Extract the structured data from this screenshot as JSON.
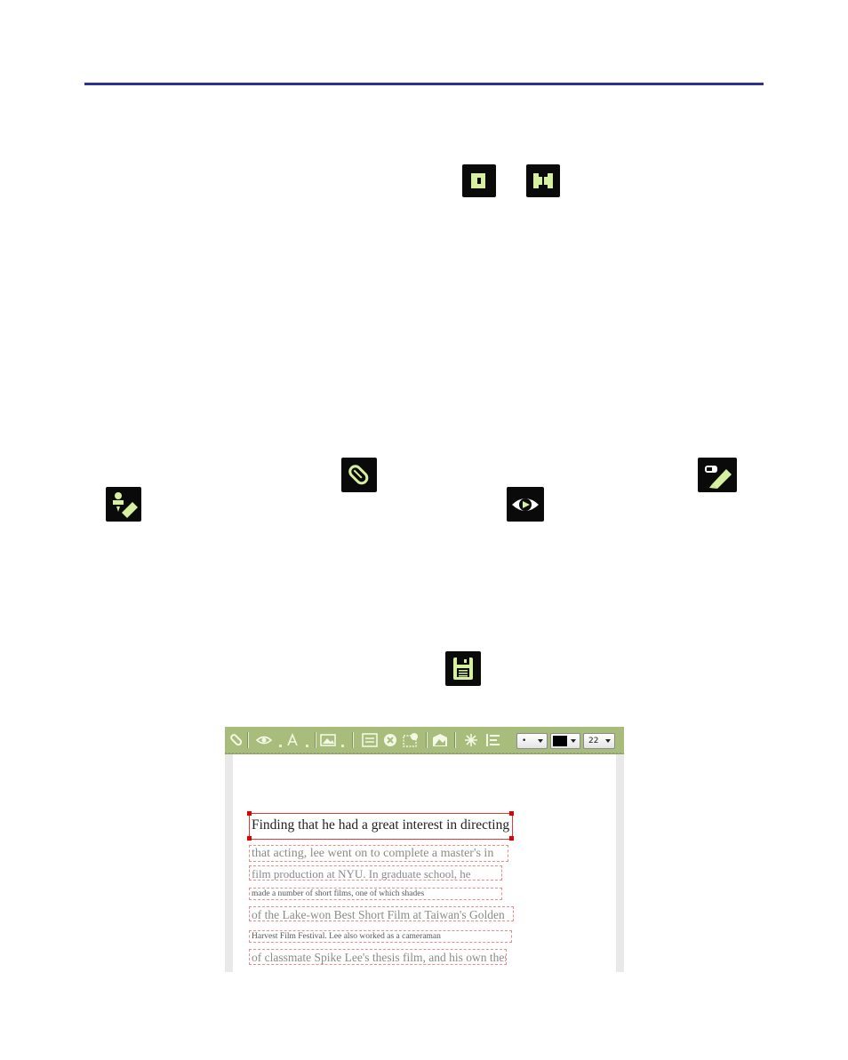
{
  "icons": {
    "toolbar_collapse": "collapse-toolbar-icon",
    "toolbar_expand": "expand-toolbar-icon",
    "pen_tool": "pen-tool-icon",
    "highlighter_tool": "highlighter-tool-icon",
    "eraser_tool": "eraser-tool-icon",
    "view_toggle": "view-toggle-icon",
    "save": "save-icon"
  },
  "colors": {
    "rule": "#2e3192",
    "toolbar_bg": "#a8bc7c",
    "selection_border": "#e23a3a",
    "line_border": "#f08a8a"
  },
  "editor": {
    "toolbar": {
      "pen_size": "•",
      "color_value": "#000000",
      "font_size": "22"
    },
    "lines": [
      "Finding that he had a great interest in directing",
      "that acting, lee went on to complete a master's in",
      "film production at NYU. In graduate school, he",
      "made a number of short films, one of which shades",
      "of the Lake-won Best Short Film at Taiwan's Golden",
      "Harvest Film Festival. Lee also worked as a cameraman",
      "of classmate Spike Lee's thesis film, and his own thesis"
    ]
  }
}
